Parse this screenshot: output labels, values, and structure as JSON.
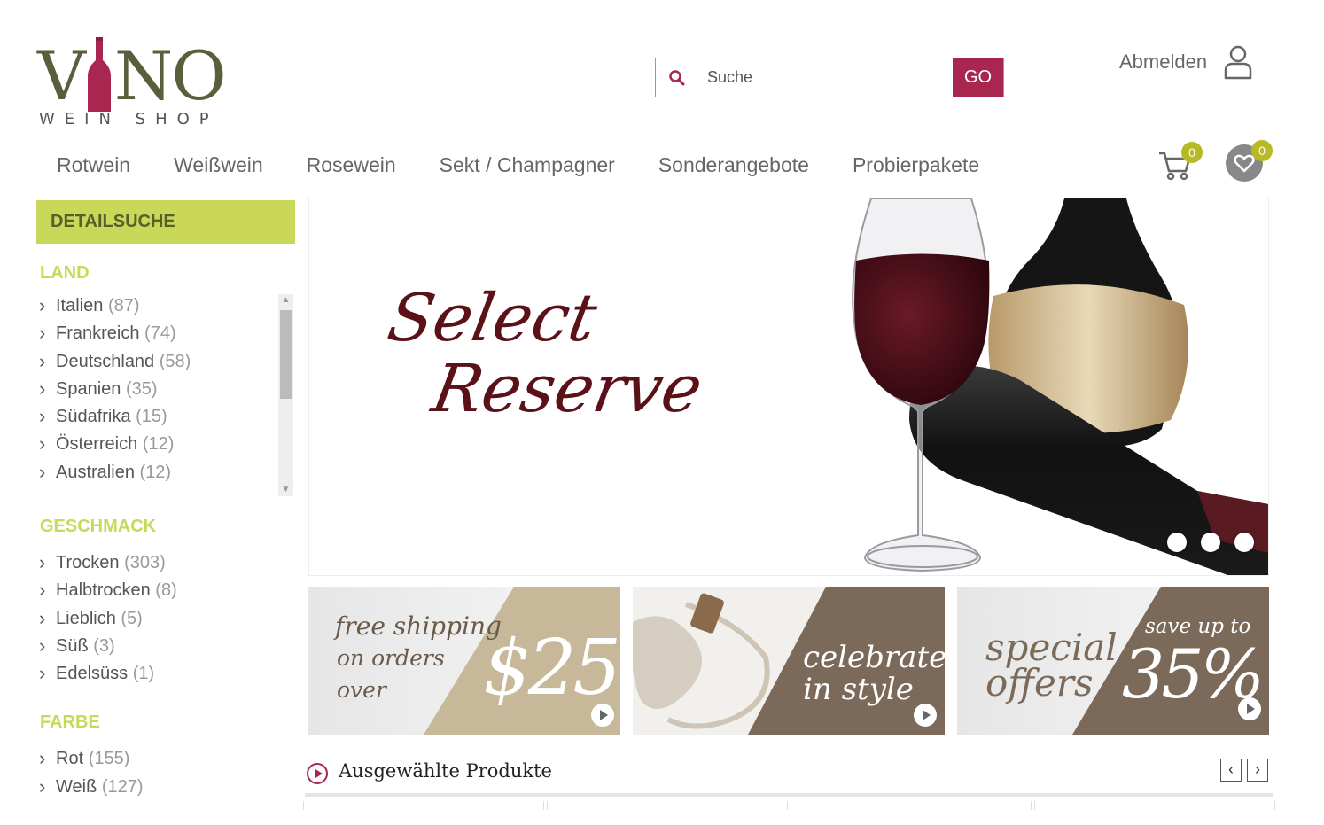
{
  "logo": {
    "letters_left": "V",
    "letters_right": "NO",
    "subtitle": "WEIN SHOP"
  },
  "search": {
    "placeholder": "Suche",
    "button_label": "GO"
  },
  "account": {
    "logout_label": "Abmelden"
  },
  "nav": {
    "items": [
      "Rotwein",
      "Weißwein",
      "Rosewein",
      "Sekt / Champagner",
      "Sonderangebote",
      "Probierpakete"
    ]
  },
  "cart": {
    "count": "0"
  },
  "wishlist": {
    "count": "0"
  },
  "sidebar": {
    "header": "DETAILSUCHE",
    "land": {
      "title": "LAND",
      "items": [
        {
          "label": "Italien",
          "count": "(87)"
        },
        {
          "label": "Frankreich",
          "count": "(74)"
        },
        {
          "label": "Deutschland",
          "count": "(58)"
        },
        {
          "label": "Spanien",
          "count": "(35)"
        },
        {
          "label": "Südafrika",
          "count": "(15)"
        },
        {
          "label": "Österreich",
          "count": "(12)"
        },
        {
          "label": "Australien",
          "count": "(12)"
        }
      ]
    },
    "geschmack": {
      "title": "GESCHMACK",
      "items": [
        {
          "label": "Trocken",
          "count": "(303)"
        },
        {
          "label": "Halbtrocken",
          "count": "(8)"
        },
        {
          "label": "Lieblich",
          "count": "(5)"
        },
        {
          "label": "Süß",
          "count": "(3)"
        },
        {
          "label": "Edelsüss",
          "count": "(1)"
        }
      ]
    },
    "farbe": {
      "title": "FARBE",
      "items": [
        {
          "label": "Rot",
          "count": "(155)"
        },
        {
          "label": "Weiß",
          "count": "(127)"
        }
      ]
    }
  },
  "hero": {
    "line1": "Select",
    "line2": "Reserve",
    "slide_count": 3
  },
  "promos": [
    {
      "line1": "free shipping",
      "line2": "on orders",
      "line3": "over",
      "big": "$25"
    },
    {
      "line1": "celebrate",
      "line2": "in style"
    },
    {
      "line1": "special",
      "line2": "offers",
      "small": "save up to",
      "big": "35%"
    }
  ],
  "featured": {
    "title": "Ausgewählte Produkte",
    "prev_icon": "chevron-left-icon",
    "next_icon": "chevron-right-icon"
  },
  "colors": {
    "brand_red": "#a8264f",
    "lime": "#cad85a",
    "olive_logo": "#5a5e3a",
    "promo_tan": "#c7b89a",
    "promo_brown": "#7b6a5a",
    "hero_script": "#5b1118"
  }
}
